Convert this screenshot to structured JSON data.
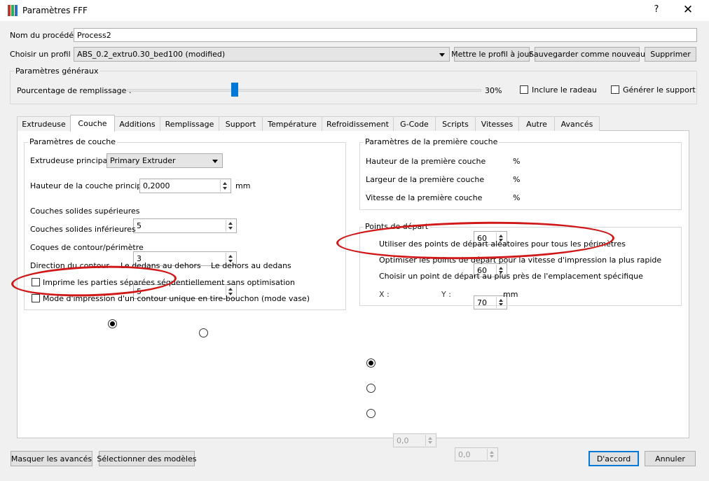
{
  "window": {
    "title": "Paramètres FFF",
    "help_glyph": "?",
    "close_glyph": "✕",
    "icon_colors": [
      "#c0392b",
      "#27ae60",
      "#2c6fbf"
    ]
  },
  "process": {
    "name_label": "Nom du procédé :",
    "name_value": "Process2",
    "profile_label": "Choisir un profil :",
    "profile_value": "ABS_0.2_extru0.30_bed100 (modified)",
    "update_button": "Mettre le profil à jour",
    "save_new_button": "Sauvegarder comme nouveau",
    "delete_button": "Supprimer"
  },
  "general": {
    "title": "Paramètres généraux",
    "infill_label": "Pourcentage de remplissage :",
    "infill_value": "30%",
    "infill_fraction": 0.3,
    "raft_label": "Inclure le radeau",
    "support_label": "Générer le support"
  },
  "tabs": [
    {
      "label": "Extrudeuse"
    },
    {
      "label": "Couche",
      "active": true
    },
    {
      "label": "Additions"
    },
    {
      "label": "Remplissage"
    },
    {
      "label": "Support"
    },
    {
      "label": "Température"
    },
    {
      "label": "Refroidissement"
    },
    {
      "label": "G-Code"
    },
    {
      "label": "Scripts"
    },
    {
      "label": "Vitesses"
    },
    {
      "label": "Autre"
    },
    {
      "label": "Avancés"
    }
  ],
  "layer": {
    "title": "Paramètres de couche",
    "main_extruder_label": "Extrudeuse principale",
    "main_extruder_value": "Primary Extruder",
    "layer_height_label": "Hauteur de la couche principale",
    "layer_height_value": "0,2000",
    "layer_height_unit": "mm",
    "top_layers_label": "Couches solides supérieures",
    "top_layers_value": "5",
    "bottom_layers_label": "Couches solides inférieures",
    "bottom_layers_value": "3",
    "perimeters_label": "Coques de contour/périmètre",
    "perimeters_value": "5",
    "direction_label": "Direction du contour",
    "direction_inside_out": "Le dedans au dehors",
    "direction_outside_in": "Le dehors au dedans",
    "sequential_label": "Imprime les parties séparées séquentiellement sans optimisation",
    "vase_label": "Mode d'impression d'un contour unique en tire-bouchon (mode vase)"
  },
  "first_layer": {
    "title": "Paramètres de la première couche",
    "height_label": "Hauteur de la première couche",
    "height_value": "60",
    "width_label": "Largeur de la première couche",
    "width_value": "60",
    "speed_label": "Vitesse de la première couche",
    "speed_value": "70",
    "unit": "%"
  },
  "start_points": {
    "title": "Points de départ",
    "random_label": "Utiliser des points de départ aléatoires pour tous les périmètres",
    "optimize_label": "Optimiser les points de départ pour la vitesse d'impression la plus rapide",
    "specific_label": "Choisir un point de départ au plus près de l'emplacement spécifique",
    "x_label": "X :",
    "x_value": "0,0",
    "y_label": "Y :",
    "y_value": "0,0",
    "unit": "mm"
  },
  "footer": {
    "hide_advanced": "Masquer les avancés",
    "select_models": "Sélectionner des modèles",
    "ok": "D'accord",
    "cancel": "Annuler"
  },
  "annotations": {
    "ellipse_color": "#d01818"
  }
}
